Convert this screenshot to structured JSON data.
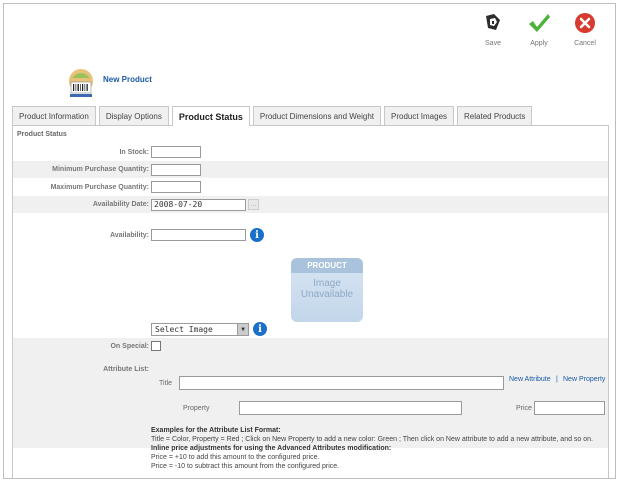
{
  "toolbar": {
    "save": "Save",
    "apply": "Apply",
    "cancel": "Cancel"
  },
  "header": {
    "title": "New Product"
  },
  "tabs": [
    {
      "label": "Product Information",
      "active": false
    },
    {
      "label": "Display Options",
      "active": false
    },
    {
      "label": "Product Status",
      "active": true
    },
    {
      "label": "Product Dimensions and Weight",
      "active": false
    },
    {
      "label": "Product Images",
      "active": false
    },
    {
      "label": "Related Products",
      "active": false
    }
  ],
  "status": {
    "section_title": "Product Status",
    "in_stock_label": "In Stock:",
    "in_stock_value": "",
    "min_qty_label": "Minimum Purchase Quantity:",
    "min_qty_value": "",
    "max_qty_label": "Maximum Purchase Quantity:",
    "max_qty_value": "",
    "availability_date_label": "Availability Date:",
    "availability_date_value": "2008-07-20",
    "availability_label": "Availability:",
    "availability_value": "",
    "image_placeholder_top": "PRODUCT",
    "image_placeholder_line1": "Image",
    "image_placeholder_line2": "Unavailable",
    "select_image": "Select Image",
    "on_special_label": "On Special:",
    "on_special_checked": false
  },
  "attributes": {
    "label": "Attribute List:",
    "title_label": "Title",
    "title_value": "",
    "new_attribute_link": "New Attribute",
    "separator": "|",
    "new_property_link": "New Property",
    "property_label": "Property",
    "property_value": "",
    "price_label": "Price",
    "price_value": ""
  },
  "examples": {
    "heading": "Examples for the Attribute List Format:",
    "line1": "Title = Color, Property = Red ; Click on New Property to add a new color: Green ; Then click on New attribute to add a new attribute, and so on.",
    "heading2": "Inline price adjustments for using the Advanced Attributes modification:",
    "line2": "Price = +10 to add this amount to the configured price.",
    "line3": "Price = -10 to subtract this amount from the configured price."
  },
  "colors": {
    "link": "#1a5aa5",
    "info_icon": "#1a6fc9",
    "save_icon": "#333333",
    "apply_icon": "#4bb33a",
    "cancel_icon": "#d93a2f"
  }
}
